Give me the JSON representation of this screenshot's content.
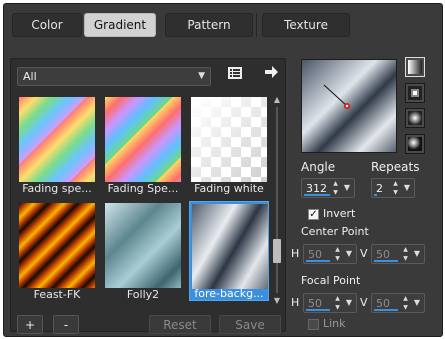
{
  "tabs": [
    {
      "label": "Color",
      "active": false
    },
    {
      "label": "Gradient",
      "active": true
    },
    {
      "label": "Pattern",
      "active": false
    },
    {
      "label": "Texture",
      "active": false
    }
  ],
  "library": {
    "category": "All",
    "tiles": [
      {
        "label": "Fading spe...",
        "selected": false
      },
      {
        "label": "Fading Spe...",
        "selected": false
      },
      {
        "label": "Fading white",
        "selected": false
      },
      {
        "label": "Feast-FK",
        "selected": false
      },
      {
        "label": "Folly2",
        "selected": false
      },
      {
        "label": "fore-backg...",
        "selected": true
      }
    ],
    "buttons": {
      "add": "+",
      "remove": "-",
      "reset": "Reset",
      "save": "Save"
    }
  },
  "gradient": {
    "angle_label": "Angle",
    "angle": "312",
    "repeats_label": "Repeats",
    "repeats": "2",
    "invert_label": "Invert",
    "invert_checked": true,
    "center_label": "Center Point",
    "center_h": "50",
    "center_v": "50",
    "focal_label": "Focal Point",
    "focal_h": "50",
    "focal_v": "50",
    "h_label": "H",
    "v_label": "V",
    "link_label": "Link",
    "link_checked": false
  },
  "colors": {
    "accent": "#3c8fdc",
    "background": "#3a3a3a"
  }
}
